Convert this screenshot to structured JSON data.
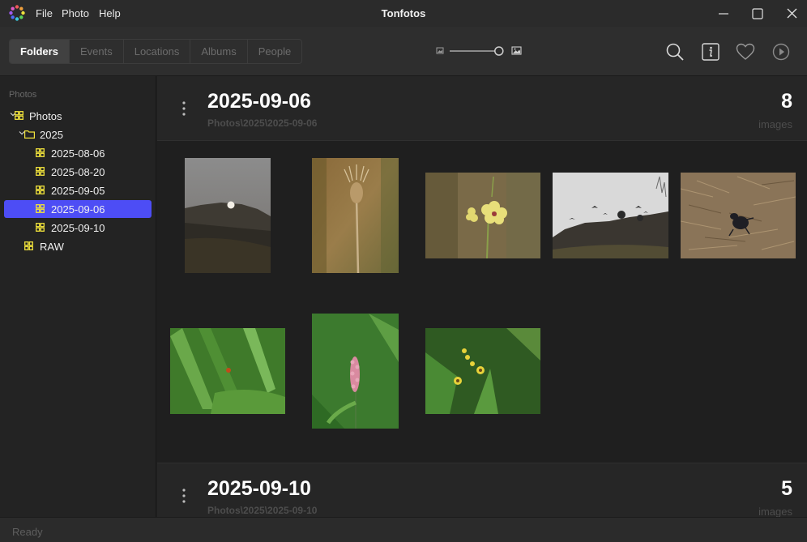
{
  "window": {
    "title": "Tonfotos",
    "menu": [
      "File",
      "Photo",
      "Help"
    ]
  },
  "toolbar": {
    "tabs": [
      "Folders",
      "Events",
      "Locations",
      "Albums",
      "People"
    ],
    "active_tab": "Folders",
    "thumbnail_size": 0.8
  },
  "sidebar": {
    "heading": "Photos",
    "tree": [
      {
        "label": "Photos",
        "level": 0,
        "expanded": true,
        "icon": "grid-icon"
      },
      {
        "label": "2025",
        "level": 1,
        "expanded": true,
        "icon": "folder-icon"
      },
      {
        "label": "2025-08-06",
        "level": 2,
        "icon": "grid-icon"
      },
      {
        "label": "2025-08-20",
        "level": 2,
        "icon": "grid-icon"
      },
      {
        "label": "2025-09-05",
        "level": 2,
        "icon": "grid-icon"
      },
      {
        "label": "2025-09-06",
        "level": 2,
        "icon": "grid-icon",
        "selected": true
      },
      {
        "label": "2025-09-10",
        "level": 2,
        "icon": "grid-icon"
      },
      {
        "label": "RAW",
        "level": 1,
        "icon": "grid-icon"
      }
    ]
  },
  "groups": [
    {
      "title": "2025-09-06",
      "path": "Photos\\2025\\2025-09-06",
      "count": "8",
      "unit": "images"
    },
    {
      "title": "2025-09-10",
      "path": "Photos\\2025\\2025-09-10",
      "count": "5",
      "unit": "images"
    }
  ],
  "photos": [
    "moonrise-hill-photo",
    "teasel-photo",
    "yellow-flower-photo",
    "birds-on-rock-photo",
    "dung-beetle-photo",
    "ladybug-leaves-photo",
    "pink-knotweed-photo",
    "yellow-daisies-photo"
  ],
  "status": "Ready",
  "colors": {
    "accent": "#4d4df5",
    "background": "#1f1f1f",
    "tree_icon": "#f0e23c"
  }
}
